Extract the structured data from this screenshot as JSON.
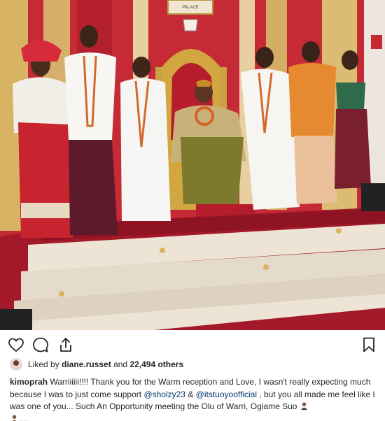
{
  "post": {
    "photo_alt": "Group photo in throne room",
    "palace_sign": "PALACE"
  },
  "actions": {
    "like_icon": "heart-outline-icon",
    "comment_icon": "comment-bubble-icon",
    "share_icon": "share-arrow-icon",
    "save_icon": "bookmark-icon"
  },
  "likes": {
    "prefix": "Liked by ",
    "user": "diane.russet",
    "middle": " and ",
    "count": "22,494 others"
  },
  "caption": {
    "username": "kimoprah",
    "text_1": " Warriiiiii!!!! Thank you for the Warm reception and Love, I wasn't really expecting much because I was to just come support ",
    "mention_1": "@sholzy23",
    "text_2": " & ",
    "mention_2": "@itstuoyoofficial",
    "text_3": " , but you all made me feel like I was one of you... Such An Opportunity meeting the Olu of Warri, Ogiame Suo ",
    "text_4": "...."
  },
  "colors": {
    "wall_red": "#c62a35",
    "carpet_red": "#a3192a",
    "gold": "#c9a246",
    "link": "#00376b"
  }
}
